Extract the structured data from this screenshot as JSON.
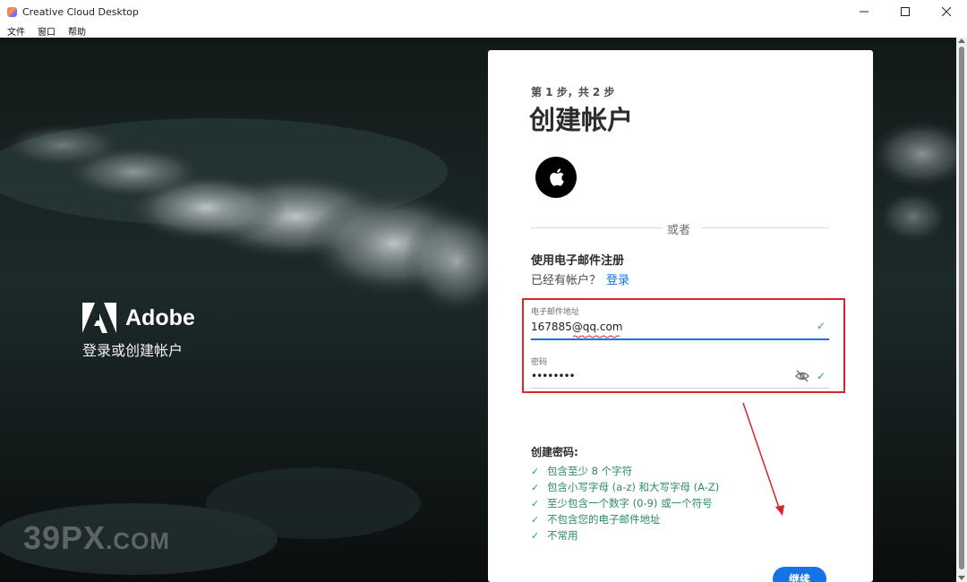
{
  "window": {
    "title": "Creative Cloud Desktop",
    "minimize_icon": "minimize-icon",
    "maximize_icon": "maximize-icon",
    "close_icon": "close-icon"
  },
  "menu": [
    "文件",
    "窗口",
    "帮助"
  ],
  "brand": {
    "name": "Adobe",
    "subtitle": "登录或创建帐户"
  },
  "watermark": {
    "main": "39PX",
    "suffix": ".COM"
  },
  "card": {
    "step": "第 1 步，共 2 步",
    "title": "创建帐户",
    "apple_icon": "apple-icon",
    "or_text": "或者",
    "email_heading": "使用电子邮件注册",
    "have_account": "已经有帐户？",
    "sign_in": "登录",
    "email": {
      "label": "电子邮件地址",
      "value": "167885@qq.com"
    },
    "password": {
      "label": "密码",
      "value": "••••••••",
      "toggle_icon": "eye-slash-icon"
    },
    "requirements_title": "创建密码:",
    "requirements": [
      "包含至少 8 个字符",
      "包含小写字母 (a-z) 和大写字母 (A-Z)",
      "至少包含一个数字 (0-9) 或一个符号",
      "不包含您的电子邮件地址",
      "不常用"
    ],
    "continue_label": "继续"
  },
  "colors": {
    "accent": "#1473e6",
    "success": "#2d9d78",
    "highlight": "#d9242b"
  }
}
